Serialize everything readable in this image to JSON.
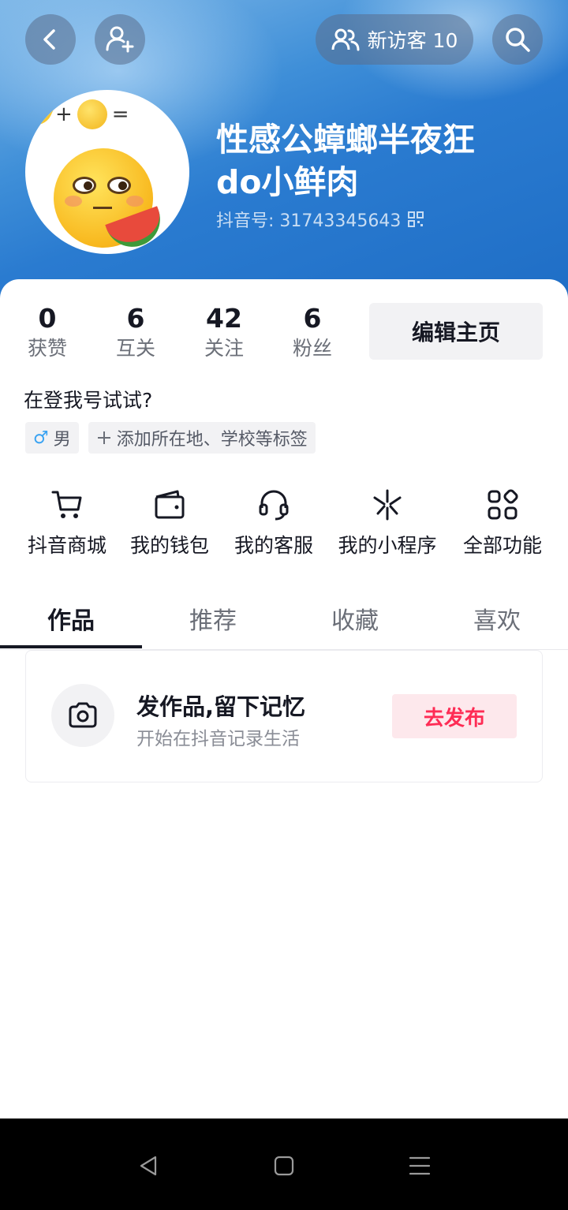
{
  "header": {
    "visitor_label": "新访客 10",
    "nickname_line1": "性感公蟑螂半夜狂",
    "nickname_line2": "do小鲜肉",
    "douyin_id": "抖音号: 31743345643",
    "avatar_eq_plus": "+",
    "avatar_eq_equals": "="
  },
  "stats": [
    {
      "value": "0",
      "label": "获赞"
    },
    {
      "value": "6",
      "label": "互关"
    },
    {
      "value": "42",
      "label": "关注"
    },
    {
      "value": "6",
      "label": "粉丝"
    }
  ],
  "edit_button_label": "编辑主页",
  "bio": "在登我号试试?",
  "tags": {
    "gender_symbol": "♂",
    "gender": "男",
    "add_label": "添加所在地、学校等标签"
  },
  "functions": [
    {
      "label": "抖音商城",
      "icon": "cart-icon"
    },
    {
      "label": "我的钱包",
      "icon": "wallet-icon"
    },
    {
      "label": "我的客服",
      "icon": "headset-icon"
    },
    {
      "label": "我的小程序",
      "icon": "mini-program-icon"
    },
    {
      "label": "全部功能",
      "icon": "grid-icon"
    }
  ],
  "tabs": [
    {
      "label": "作品",
      "active": true
    },
    {
      "label": "推荐",
      "active": false
    },
    {
      "label": "收藏",
      "active": false
    },
    {
      "label": "喜欢",
      "active": false
    }
  ],
  "post_card": {
    "title": "发作品,留下记忆",
    "subtitle": "开始在抖音记录生活",
    "button_label": "去发布"
  },
  "colors": {
    "accent": "#fe2c55",
    "header_blue": "#2a7bd0"
  }
}
